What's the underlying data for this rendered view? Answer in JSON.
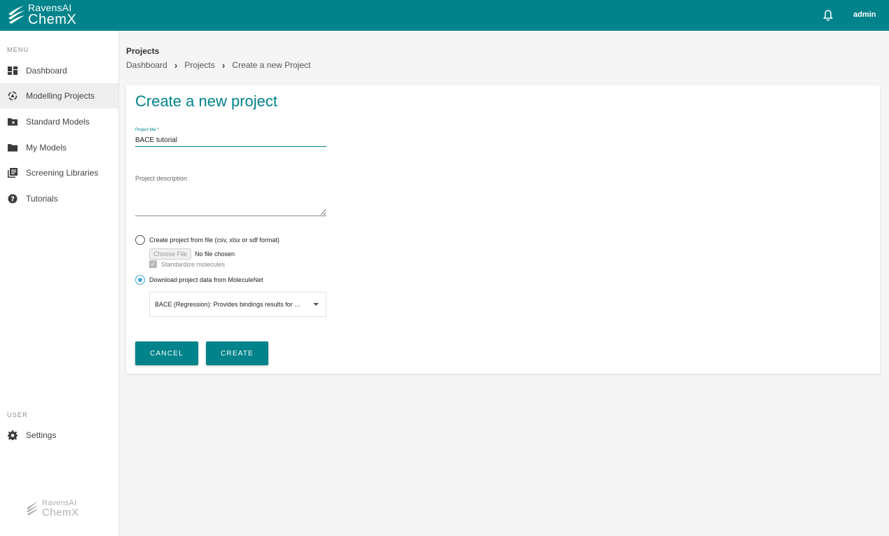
{
  "brand": {
    "line1": "RavensAI",
    "line2": "ChemX"
  },
  "header": {
    "user": "admin",
    "bell_icon": "bell-icon"
  },
  "sidebar": {
    "menu_label": "MENU",
    "items": [
      {
        "label": "Dashboard",
        "icon": "dashboard-icon"
      },
      {
        "label": "Modelling Projects",
        "icon": "modelling-icon",
        "active": true
      },
      {
        "label": "Standard Models",
        "icon": "folder-star-icon"
      },
      {
        "label": "My Models",
        "icon": "folder-icon"
      },
      {
        "label": "Screening Libraries",
        "icon": "library-icon"
      },
      {
        "label": "Tutorials",
        "icon": "help-icon"
      }
    ],
    "user_label": "USER",
    "user_items": [
      {
        "label": "Settings",
        "icon": "gear-icon"
      }
    ]
  },
  "page": {
    "title": "Projects",
    "breadcrumb": [
      "Dashboard",
      "Projects",
      "Create a new Project"
    ]
  },
  "form": {
    "heading": "Create a new project",
    "title_label": "Project title *",
    "title_value": "BACE tutorial",
    "description_label": "Project description",
    "description_value": "",
    "option_file_label": "Create project from file (csv, xlsx or sdf format)",
    "choose_file_label": "Choose File",
    "no_file_label": "No file chosen",
    "standardize_label": "Standardize molecules",
    "option_moleculenet_label": "Download project data from MoleculeNet",
    "selected_option": "moleculenet",
    "dataset_selected": "BACE (Regression): Provides bindings results for …",
    "cancel_label": "CANCEL",
    "create_label": "CREATE"
  },
  "colors": {
    "primary": "#00838a",
    "radio_accent": "#4aa8d8"
  }
}
